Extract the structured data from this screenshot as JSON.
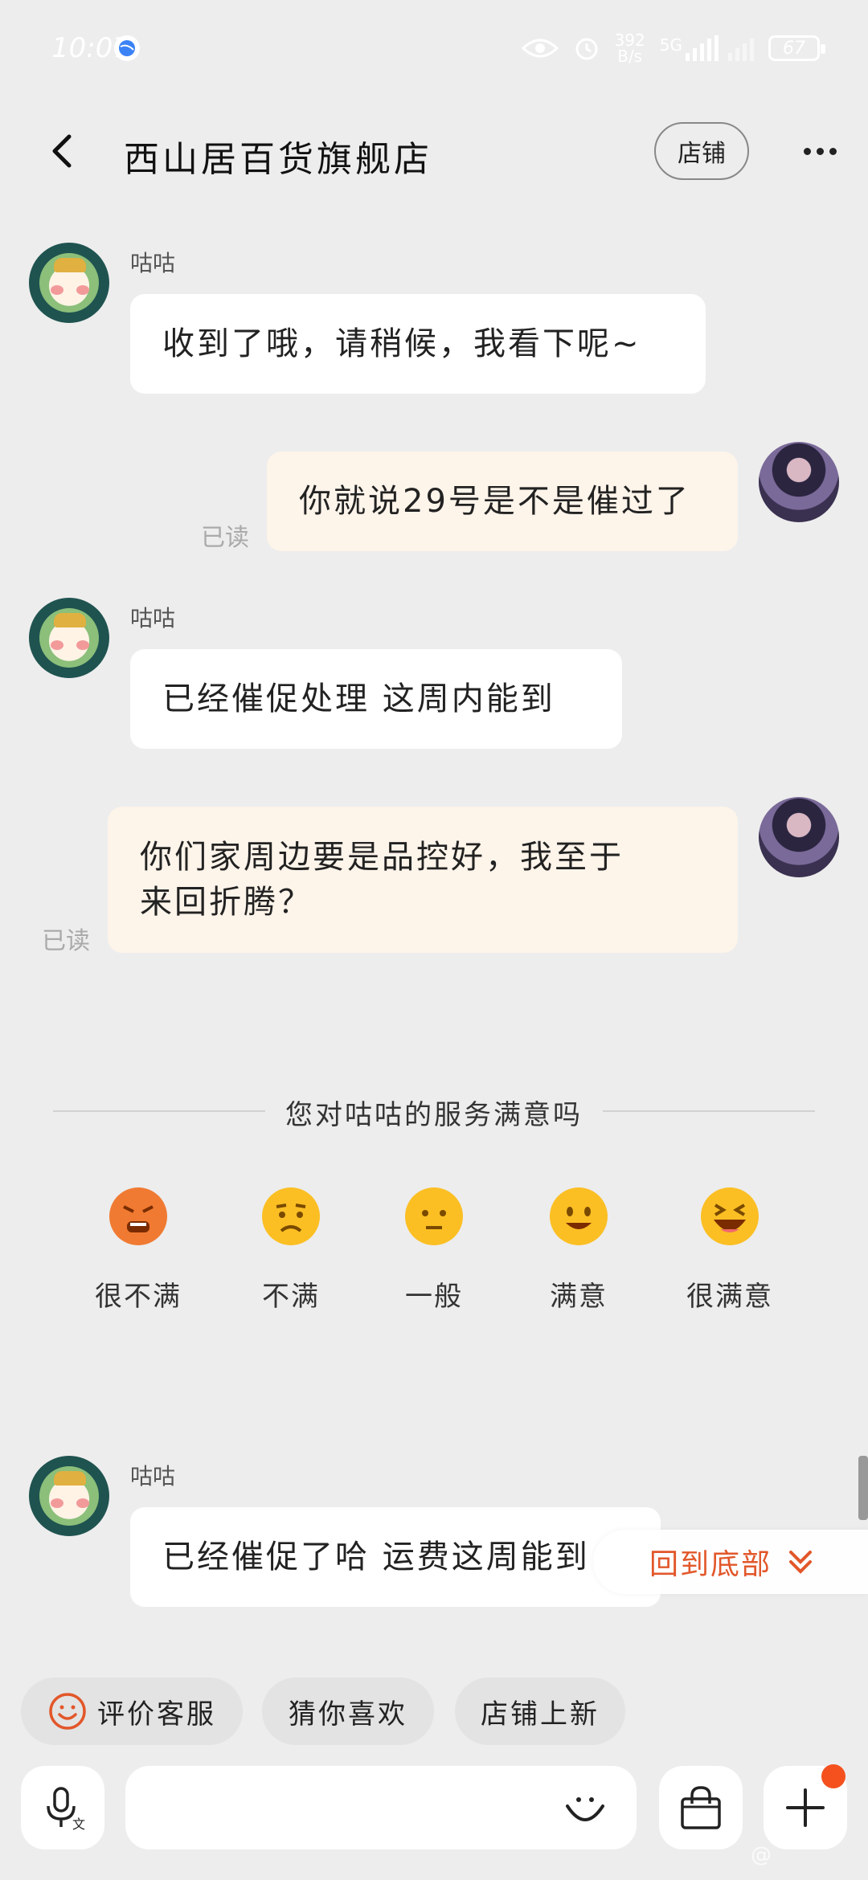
{
  "status": {
    "time": "10:07",
    "speed_value": "392",
    "speed_unit": "B/s",
    "network": "5G",
    "battery": "67"
  },
  "header": {
    "title": "西山居百货旗舰店",
    "shop_label": "店铺"
  },
  "messages": [
    {
      "sender": "咕咕",
      "text": "收到了哦，请稍候，我看下呢~"
    },
    {
      "text": "你就说29号是不是催过了",
      "read": "已读"
    },
    {
      "sender": "咕咕",
      "text": "已经催促处理 这周内能到"
    },
    {
      "text_line1": "你们家周边要是品控好，我至于",
      "text_line2": "来回折腾？",
      "read": "已读"
    },
    {
      "sender": "咕咕",
      "text": "已经催促了哈 运费这周能到"
    }
  ],
  "survey": {
    "title": "您对咕咕的服务满意吗",
    "options": [
      {
        "label": "很不满",
        "icon": "angry-face-icon",
        "color": "#f07a32"
      },
      {
        "label": "不满",
        "icon": "frown-face-icon",
        "color": "#fbbf24"
      },
      {
        "label": "一般",
        "icon": "neutral-face-icon",
        "color": "#fbbf24"
      },
      {
        "label": "满意",
        "icon": "smile-face-icon",
        "color": "#fbbf24"
      },
      {
        "label": "很满意",
        "icon": "laugh-face-icon",
        "color": "#fbbf24"
      }
    ]
  },
  "back_to_bottom": "回到底部",
  "quick_actions": [
    {
      "label": "评价客服",
      "icon": "smile-icon"
    },
    {
      "label": "猜你喜欢"
    },
    {
      "label": "店铺上新"
    }
  ],
  "watermark": "@",
  "accent_color": "#e2572a"
}
